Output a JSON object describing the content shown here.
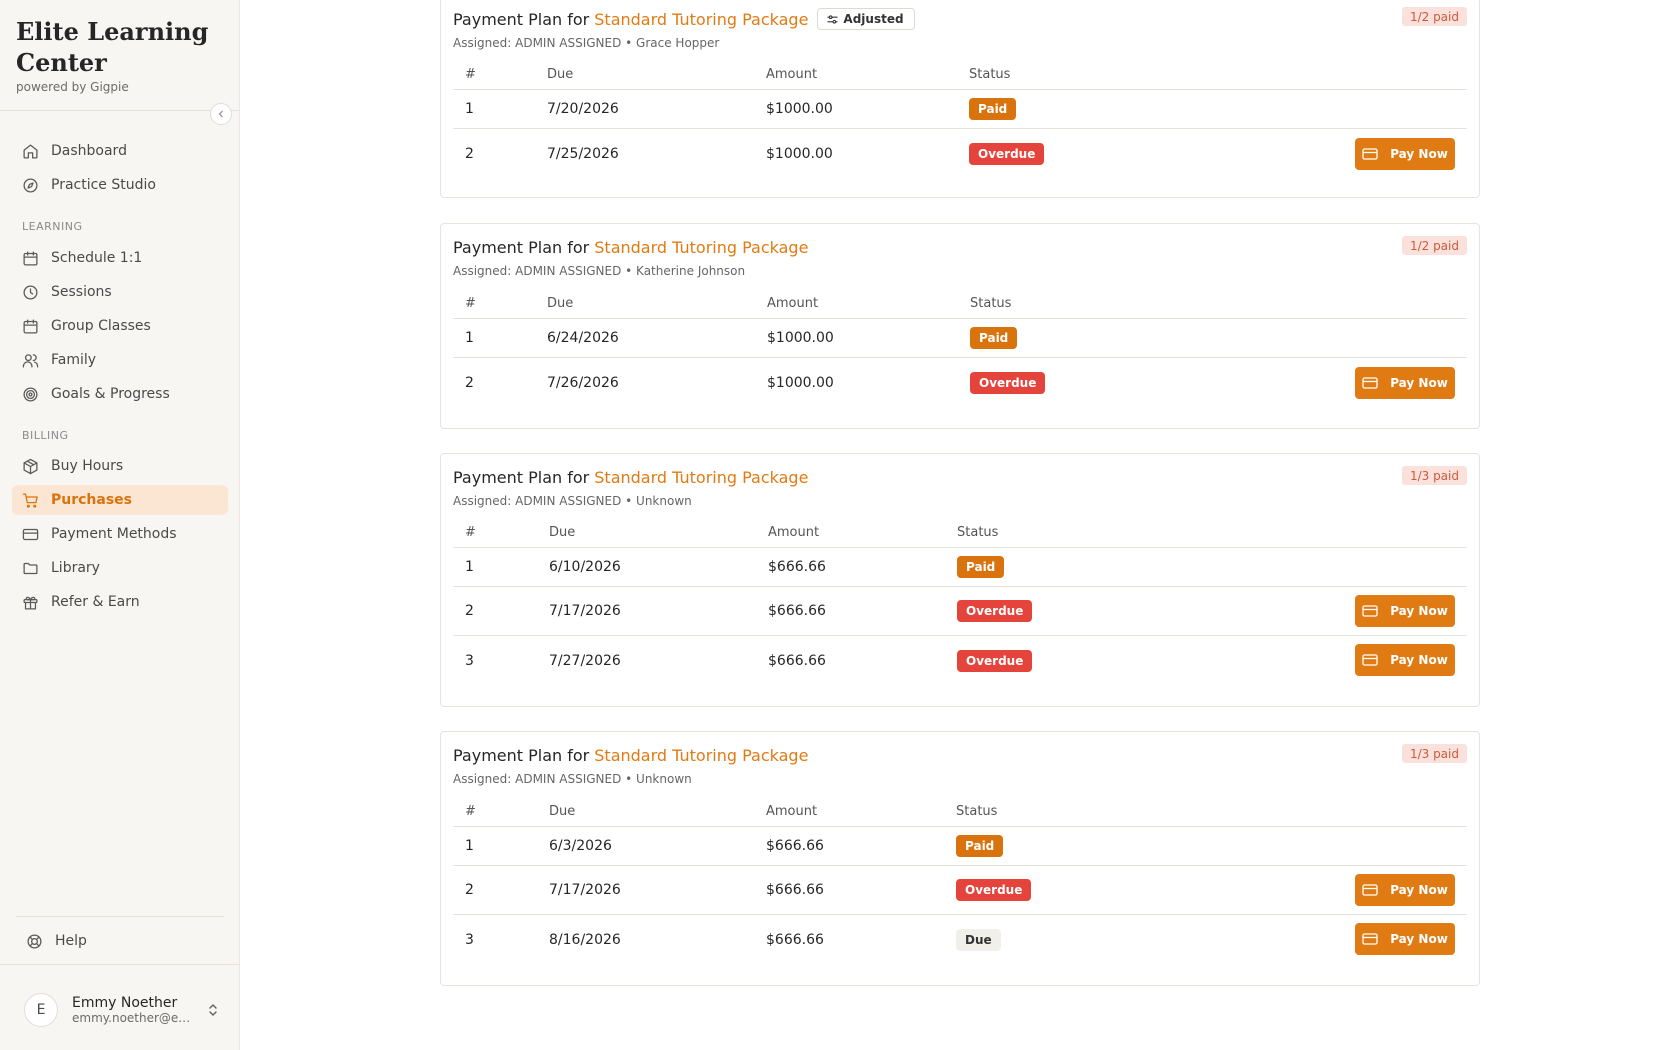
{
  "brand": {
    "title": "Elite Learning Center",
    "subtitle": "powered by Gigpie"
  },
  "nav": {
    "top": [
      {
        "label": "Dashboard",
        "icon": "home-icon"
      },
      {
        "label": "Practice Studio",
        "icon": "compass-icon"
      }
    ],
    "learning_label": "LEARNING",
    "learning": [
      {
        "label": "Schedule 1:1",
        "icon": "calendar-icon"
      },
      {
        "label": "Sessions",
        "icon": "clock-icon"
      },
      {
        "label": "Group Classes",
        "icon": "calendar-icon"
      },
      {
        "label": "Family",
        "icon": "users-icon"
      },
      {
        "label": "Goals & Progress",
        "icon": "target-icon"
      }
    ],
    "billing_label": "BILLING",
    "billing": [
      {
        "label": "Buy Hours",
        "icon": "package-icon"
      },
      {
        "label": "Purchases",
        "icon": "cart-icon",
        "active": true
      },
      {
        "label": "Payment Methods",
        "icon": "credit-card-icon"
      },
      {
        "label": "Library",
        "icon": "folder-icon"
      },
      {
        "label": "Refer & Earn",
        "icon": "gift-icon"
      }
    ],
    "help": {
      "label": "Help",
      "icon": "lifebuoy-icon"
    }
  },
  "user": {
    "initial": "E",
    "name": "Emmy Noether",
    "email": "emmy.noether@ex..."
  },
  "table_headers": {
    "num": "#",
    "due": "Due",
    "amount": "Amount",
    "status": "Status"
  },
  "pay_label": "Pay Now",
  "colors": {
    "accent": "#e07b13",
    "paid": "#d9730d",
    "overdue": "#e5443c"
  },
  "plans": [
    {
      "title_prefix": "Payment Plan for",
      "package": "Standard Tutoring Package",
      "adjusted": "Adjusted",
      "assigned": "Assigned: ADMIN ASSIGNED • Grace Hopper",
      "paid_badge": "1/2 paid",
      "rows": [
        {
          "num": "1",
          "due": "7/20/2026",
          "amount": "$1000.00",
          "status": "Paid"
        },
        {
          "num": "2",
          "due": "7/25/2026",
          "amount": "$1000.00",
          "status": "Overdue"
        }
      ]
    },
    {
      "title_prefix": "Payment Plan for",
      "package": "Standard Tutoring Package",
      "assigned": "Assigned: ADMIN ASSIGNED • Katherine Johnson",
      "paid_badge": "1/2 paid",
      "rows": [
        {
          "num": "1",
          "due": "6/24/2026",
          "amount": "$1000.00",
          "status": "Paid"
        },
        {
          "num": "2",
          "due": "7/26/2026",
          "amount": "$1000.00",
          "status": "Overdue"
        }
      ]
    },
    {
      "title_prefix": "Payment Plan for",
      "package": "Standard Tutoring Package",
      "assigned": "Assigned: ADMIN ASSIGNED • Unknown",
      "paid_badge": "1/3 paid",
      "rows": [
        {
          "num": "1",
          "due": "6/10/2026",
          "amount": "$666.66",
          "status": "Paid"
        },
        {
          "num": "2",
          "due": "7/17/2026",
          "amount": "$666.66",
          "status": "Overdue"
        },
        {
          "num": "3",
          "due": "7/27/2026",
          "amount": "$666.66",
          "status": "Overdue"
        }
      ]
    },
    {
      "title_prefix": "Payment Plan for",
      "package": "Standard Tutoring Package",
      "assigned": "Assigned: ADMIN ASSIGNED • Unknown",
      "paid_badge": "1/3 paid",
      "rows": [
        {
          "num": "1",
          "due": "6/3/2026",
          "amount": "$666.66",
          "status": "Paid"
        },
        {
          "num": "2",
          "due": "7/17/2026",
          "amount": "$666.66",
          "status": "Overdue"
        },
        {
          "num": "3",
          "due": "8/16/2026",
          "amount": "$666.66",
          "status": "Due"
        }
      ]
    }
  ]
}
